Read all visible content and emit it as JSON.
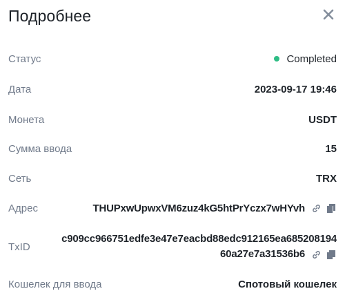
{
  "header": {
    "title": "Подробнее"
  },
  "status": {
    "label": "Статус",
    "value": "Completed",
    "dot_color": "#2ebd85"
  },
  "date": {
    "label": "Дата",
    "value": "2023-09-17 19:46"
  },
  "coin": {
    "label": "Монета",
    "value": "USDT"
  },
  "amount": {
    "label": "Сумма ввода",
    "value": "15"
  },
  "network": {
    "label": "Сеть",
    "value": "TRX"
  },
  "address": {
    "label": "Адрес",
    "value": "THUPxwUpwxVM6zuz4kG5htPrYczx7wHYvh",
    "icons": [
      "link-icon",
      "copy-icon"
    ]
  },
  "txid": {
    "label": "TxID",
    "line1": "c909cc966751edfe3e47e7eacbd88edc912165ea685208194",
    "line2": "60a27e7a31536b6",
    "icons": [
      "link-icon",
      "copy-icon"
    ]
  },
  "wallet": {
    "label": "Кошелек для ввода",
    "value": "Спотовый кошелек"
  }
}
